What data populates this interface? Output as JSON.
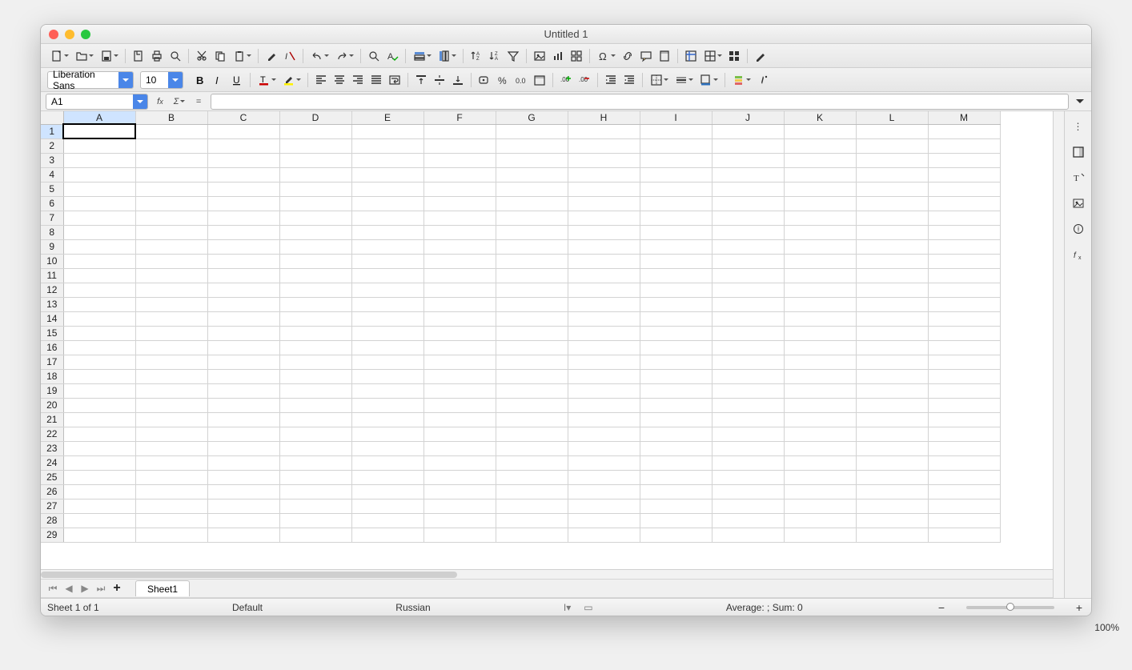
{
  "window": {
    "title": "Untitled 1"
  },
  "font": {
    "name": "Liberation Sans",
    "size": "10"
  },
  "cellref": {
    "value": "A1"
  },
  "formula": {
    "value": ""
  },
  "grid": {
    "columns": [
      "A",
      "B",
      "C",
      "D",
      "E",
      "F",
      "G",
      "H",
      "I",
      "J",
      "K",
      "L",
      "M"
    ],
    "rows": 29,
    "selected": {
      "row": 1,
      "col": "A"
    }
  },
  "tabs": {
    "active": "Sheet1"
  },
  "status": {
    "sheet_info": "Sheet 1 of 1",
    "page_style": "Default",
    "language": "Russian",
    "aggregate": "Average: ; Sum: 0",
    "zoom": "100%"
  },
  "outer_zoom": "100%",
  "toolbar1": [
    {
      "n": "new-doc-button",
      "i": "doc",
      "dd": true
    },
    {
      "n": "open-button",
      "i": "folder",
      "dd": true
    },
    {
      "n": "save-button",
      "i": "save",
      "dd": true
    },
    {
      "sep": true
    },
    {
      "n": "export-pdf-button",
      "i": "pdf"
    },
    {
      "n": "print-button",
      "i": "print"
    },
    {
      "n": "print-preview-button",
      "i": "preview"
    },
    {
      "sep": true
    },
    {
      "n": "cut-button",
      "i": "cut"
    },
    {
      "n": "copy-button",
      "i": "copy"
    },
    {
      "n": "paste-button",
      "i": "paste",
      "dd": true
    },
    {
      "sep": true
    },
    {
      "n": "clone-format-button",
      "i": "brush"
    },
    {
      "n": "clear-format-button",
      "i": "clearfmt"
    },
    {
      "sep": true
    },
    {
      "n": "undo-button",
      "i": "undo",
      "dd": true
    },
    {
      "n": "redo-button",
      "i": "redo",
      "dd": true
    },
    {
      "sep": true
    },
    {
      "n": "find-button",
      "i": "search"
    },
    {
      "n": "spellcheck-button",
      "i": "spell"
    },
    {
      "sep": true
    },
    {
      "n": "row-ops-button",
      "i": "rows",
      "dd": true
    },
    {
      "n": "col-ops-button",
      "i": "cols",
      "dd": true
    },
    {
      "sep": true
    },
    {
      "n": "sort-asc-button",
      "i": "sortasc"
    },
    {
      "n": "sort-desc-button",
      "i": "sortdesc"
    },
    {
      "n": "autofilter-button",
      "i": "filter"
    },
    {
      "sep": true
    },
    {
      "n": "insert-image-button",
      "i": "image"
    },
    {
      "n": "insert-chart-button",
      "i": "chart"
    },
    {
      "n": "pivot-button",
      "i": "pivot"
    },
    {
      "sep": true
    },
    {
      "n": "special-char-button",
      "i": "omega",
      "dd": true
    },
    {
      "n": "hyperlink-button",
      "i": "link"
    },
    {
      "n": "comment-button",
      "i": "comment"
    },
    {
      "n": "headers-footers-button",
      "i": "headerfooter"
    },
    {
      "sep": true
    },
    {
      "n": "freeze-button",
      "i": "freeze"
    },
    {
      "n": "split-window-button",
      "i": "split",
      "dd": true
    },
    {
      "n": "window-button",
      "i": "grid4"
    },
    {
      "sep": true
    },
    {
      "n": "draw-functions-button",
      "i": "pencil"
    }
  ],
  "toolbar2": [
    {
      "n": "bold-button",
      "i": "bold"
    },
    {
      "n": "italic-button",
      "i": "italic"
    },
    {
      "n": "underline-button",
      "i": "underline"
    },
    {
      "sep": true
    },
    {
      "n": "font-color-button",
      "i": "fontcolor",
      "dd": true
    },
    {
      "n": "highlight-color-button",
      "i": "highlight",
      "dd": true
    },
    {
      "sep": true
    },
    {
      "n": "align-left-button",
      "i": "aleft"
    },
    {
      "n": "align-center-button",
      "i": "acenter"
    },
    {
      "n": "align-right-button",
      "i": "aright"
    },
    {
      "n": "align-justify-button",
      "i": "ajust"
    },
    {
      "n": "wrap-text-button",
      "i": "wrap"
    },
    {
      "sep": true
    },
    {
      "n": "align-top-button",
      "i": "atop"
    },
    {
      "n": "align-middle-button",
      "i": "amid"
    },
    {
      "n": "align-bottom-button",
      "i": "abot"
    },
    {
      "sep": true
    },
    {
      "n": "currency-button",
      "i": "currency"
    },
    {
      "n": "percent-button",
      "i": "percent"
    },
    {
      "n": "number-format-button",
      "i": "numfmt"
    },
    {
      "n": "date-format-button",
      "i": "datefmt"
    },
    {
      "sep": true
    },
    {
      "n": "add-decimal-button",
      "i": "decplus"
    },
    {
      "n": "remove-decimal-button",
      "i": "decminus"
    },
    {
      "sep": true
    },
    {
      "n": "increase-indent-button",
      "i": "indinc"
    },
    {
      "n": "decrease-indent-button",
      "i": "inddec"
    },
    {
      "sep": true
    },
    {
      "n": "borders-button",
      "i": "borders",
      "dd": true
    },
    {
      "n": "border-style-button",
      "i": "borderstyle",
      "dd": true
    },
    {
      "n": "border-color-button",
      "i": "bordercolor",
      "dd": true
    },
    {
      "sep": true
    },
    {
      "n": "cond-format-button",
      "i": "condfmt",
      "dd": true
    },
    {
      "n": "cell-style-button",
      "i": "cellstyle"
    }
  ],
  "sigma": "Σ",
  "equals": "="
}
